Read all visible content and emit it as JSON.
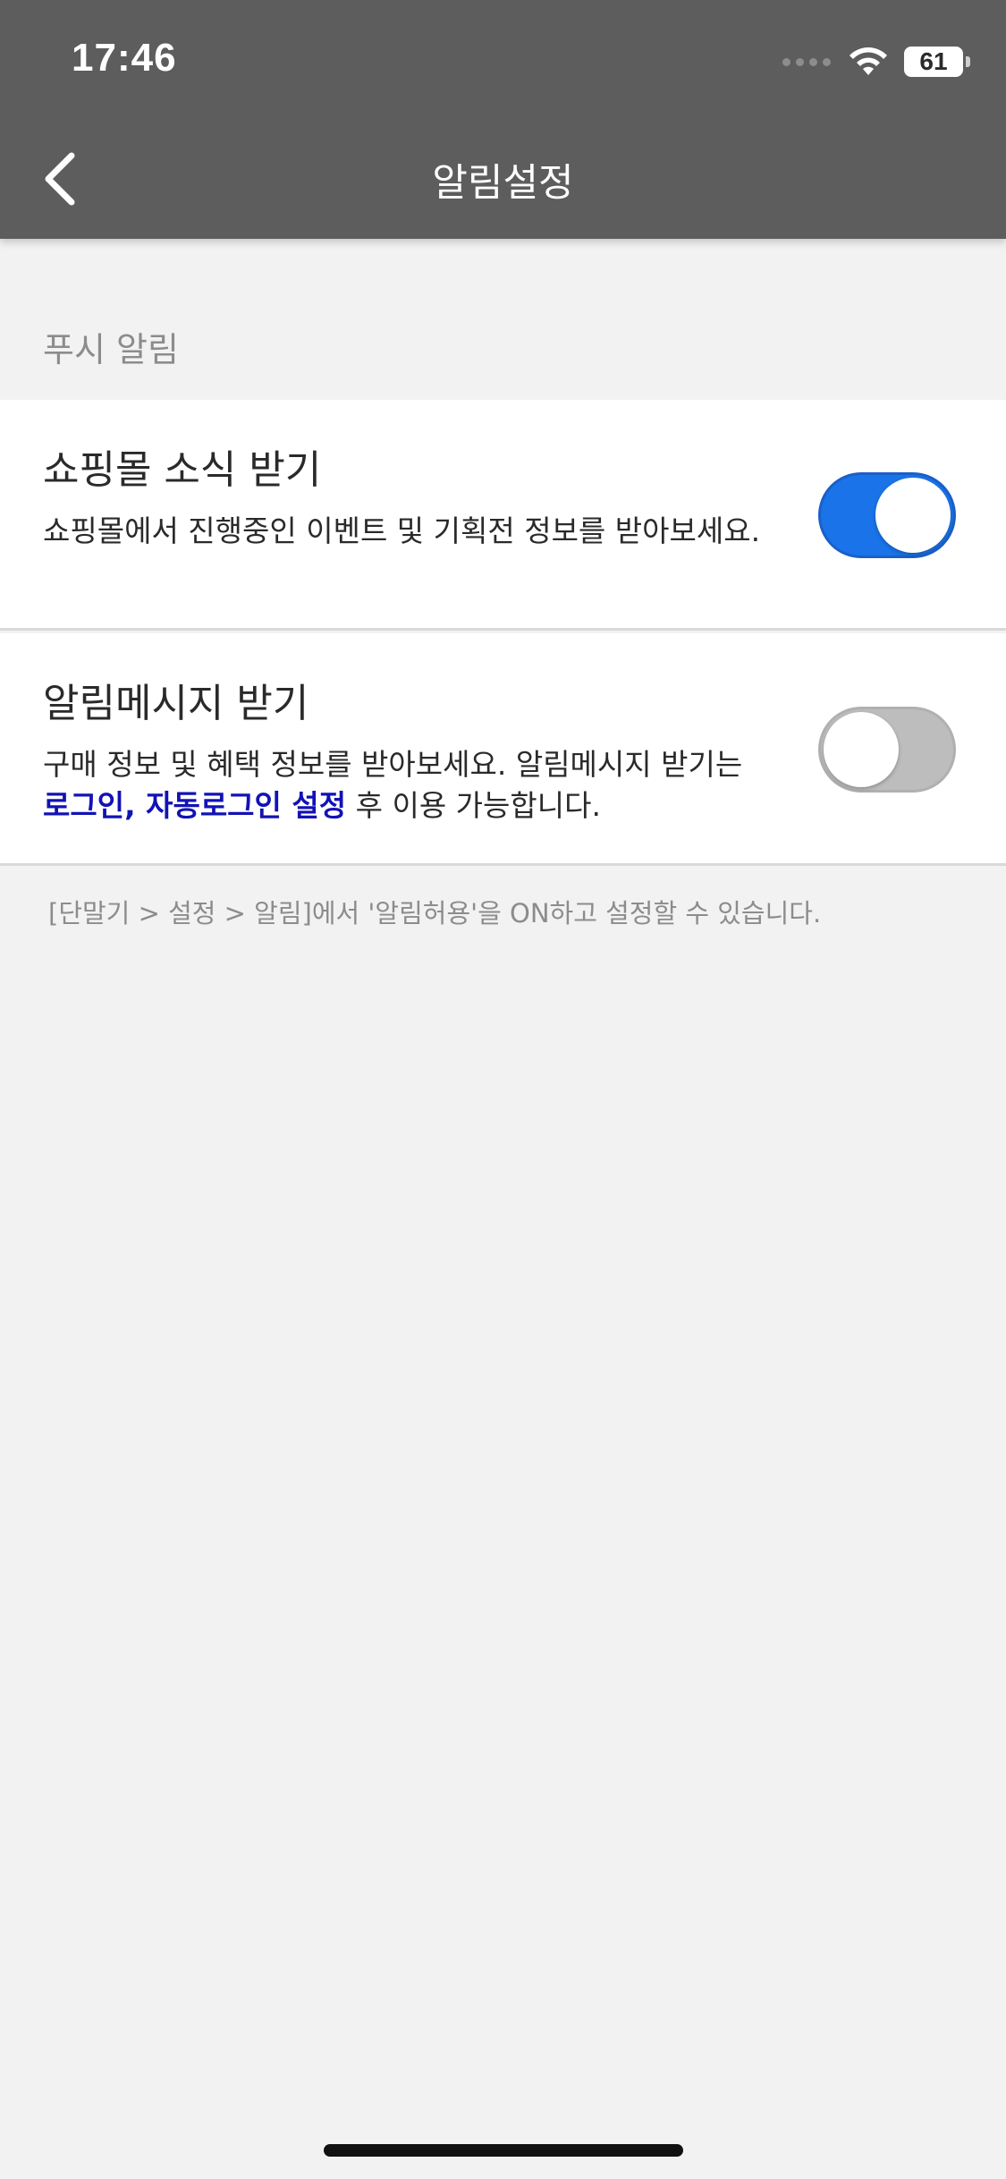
{
  "status_bar": {
    "time": "17:46",
    "battery": "61",
    "icons": [
      "signal-dots-icon",
      "wifi-icon",
      "battery-icon"
    ]
  },
  "header": {
    "title": "알림설정",
    "back_icon": "chevron-left-icon"
  },
  "section": {
    "title": "푸시 알림"
  },
  "items": [
    {
      "title": "쇼핑몰 소식 받기",
      "description": "쇼핑몰에서 진행중인 이벤트 및 기획전 정보를 받아보세요.",
      "enabled": true
    },
    {
      "title": "알림메시지 받기",
      "description_prefix": "구매 정보 및 혜택 정보를 받아보세요. 알림메시지 받기는 ",
      "description_link": "로그인, 자동로그인 설정",
      "description_suffix": " 후 이용 가능합니다.",
      "enabled": false
    }
  ],
  "footer_note": "[단말기 > 설정 > 알림]에서 '알림허용'을 ON하고 설정할 수 있습니다.",
  "colors": {
    "header_bg": "#5d5d5d",
    "toggle_on": "#1a73e8",
    "toggle_off": "#bdbdbd",
    "link": "#1212b5",
    "page_bg": "#f2f2f2"
  }
}
